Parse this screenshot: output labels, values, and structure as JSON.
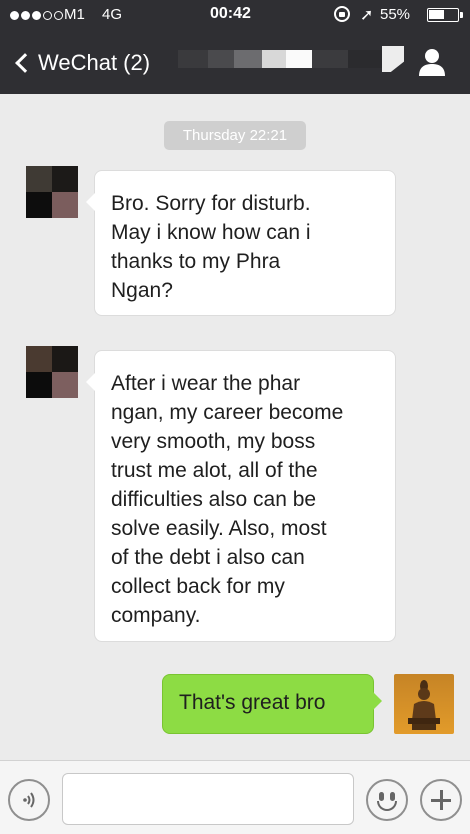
{
  "status_bar": {
    "carrier": "M1",
    "network": "4G",
    "time": "00:42",
    "battery": "55%",
    "battery_level": 0.55,
    "signal_bars": 3,
    "signal_max": 5
  },
  "nav": {
    "back_label": "WeChat (2)",
    "back_icon": "chevron-left-icon",
    "contact_icon": "person-icon"
  },
  "chat": {
    "timestamp": "Thursday 22:21",
    "messages": [
      {
        "direction": "incoming",
        "text": "Bro. Sorry for disturb.\nMay i know how can i\nthanks to my Phra\nNgan?"
      },
      {
        "direction": "incoming",
        "text": "After i wear the phar\nngan, my career become\nvery smooth, my boss\ntrust me alot, all of the\ndifficulties also can be\nsolve easily. Also, most\nof the debt i also can\ncollect back for my\ncompany."
      },
      {
        "direction": "outgoing",
        "text": "That's great bro"
      }
    ]
  },
  "input": {
    "placeholder": "",
    "voice_icon": "voice-icon",
    "emoji_icon": "emoji-icon",
    "plus_icon": "plus-icon"
  },
  "colors": {
    "header_bg": "#2f2f33",
    "chat_bg": "#ebebeb",
    "outgoing_bubble": "#8ddc44",
    "incoming_bubble": "#ffffff"
  }
}
